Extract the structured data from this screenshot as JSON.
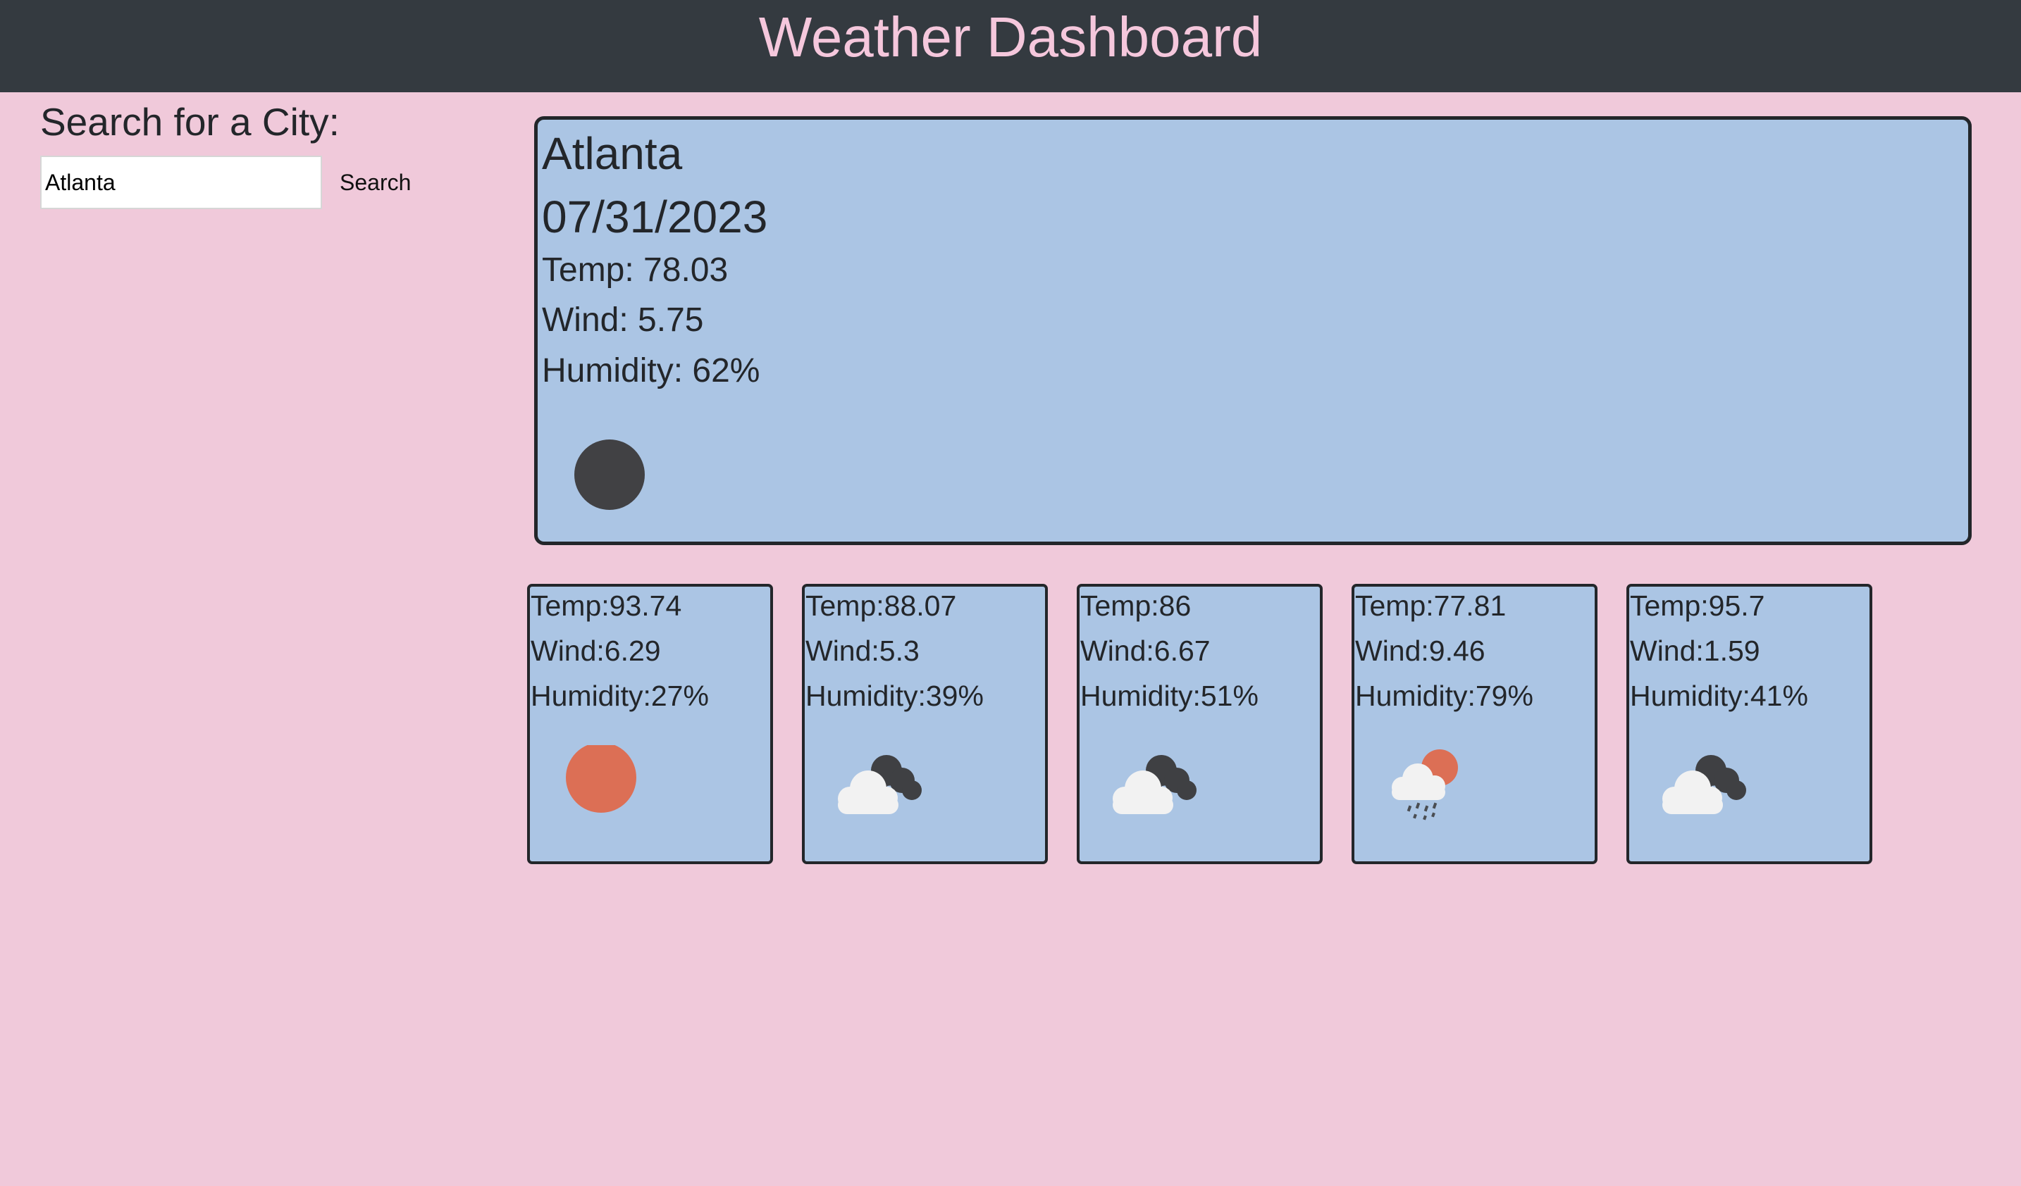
{
  "header": {
    "title": "Weather Dashboard"
  },
  "search": {
    "label": "Search for a City:",
    "value": "Atlanta",
    "button_label": "Search"
  },
  "current": {
    "city": "Atlanta",
    "date": "07/31/2023",
    "temp": "Temp: 78.03",
    "wind": "Wind: 5.75",
    "humidity": "Humidity: 62%",
    "icon": "clear-night-moon-icon"
  },
  "forecast": [
    {
      "temp": "Temp:93.74",
      "wind": "Wind:6.29",
      "humidity": "Humidity:27%",
      "icon": "sun-icon"
    },
    {
      "temp": "Temp:88.07",
      "wind": "Wind:5.3",
      "humidity": "Humidity:39%",
      "icon": "broken-clouds-icon"
    },
    {
      "temp": "Temp:86",
      "wind": "Wind:6.67",
      "humidity": "Humidity:51%",
      "icon": "broken-clouds-icon"
    },
    {
      "temp": "Temp:77.81",
      "wind": "Wind:9.46",
      "humidity": "Humidity:79%",
      "icon": "rain-sun-icon"
    },
    {
      "temp": "Temp:95.7",
      "wind": "Wind:1.59",
      "humidity": "Humidity:41%",
      "icon": "broken-clouds-icon"
    }
  ],
  "colors": {
    "page_background": "#f0c9da",
    "header_background": "#343a40",
    "header_text": "#f5c7dc",
    "card_background": "#abc5e4",
    "card_border": "#23262a",
    "sun": "#dc6f55",
    "moon": "#414144"
  }
}
